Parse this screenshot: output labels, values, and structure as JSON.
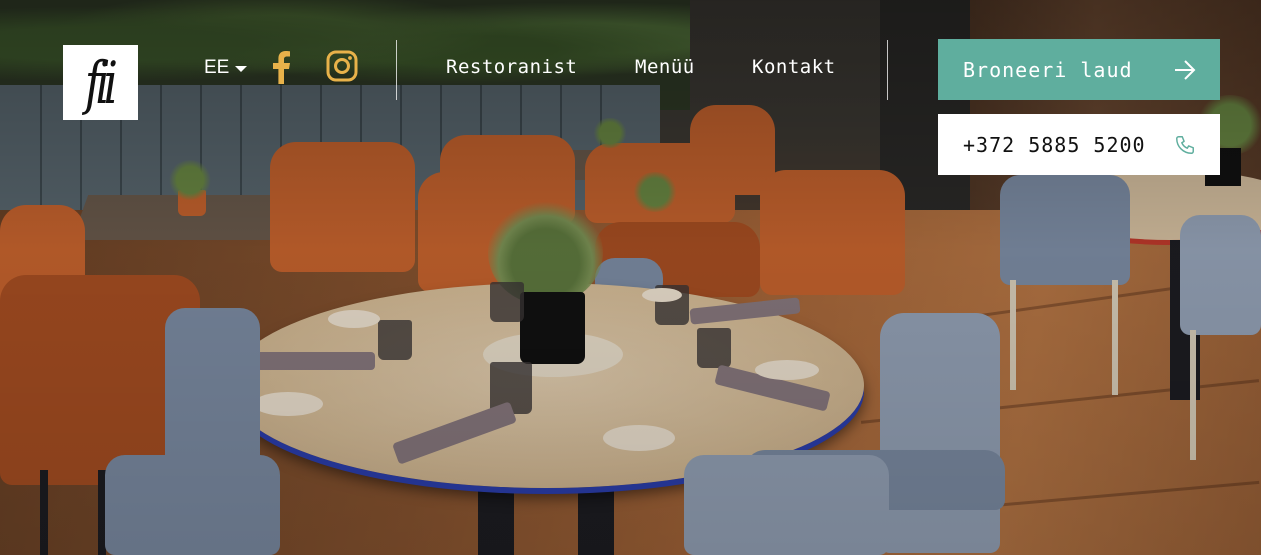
{
  "logo": {
    "text": "fii"
  },
  "language": {
    "selected": "EE",
    "icon": "chevron-down-icon"
  },
  "social": {
    "facebook_icon": "facebook-icon",
    "instagram_icon": "instagram-icon",
    "color": "#e8b24a"
  },
  "nav": {
    "items": [
      {
        "label": "Restoranist"
      },
      {
        "label": "Menüü"
      },
      {
        "label": "Kontakt"
      }
    ]
  },
  "cta": {
    "book_label": "Broneeri laud",
    "book_icon": "arrow-right-icon",
    "book_color": "#5fae9e",
    "phone_label": "+372 5885 5200",
    "phone_icon": "phone-icon"
  }
}
